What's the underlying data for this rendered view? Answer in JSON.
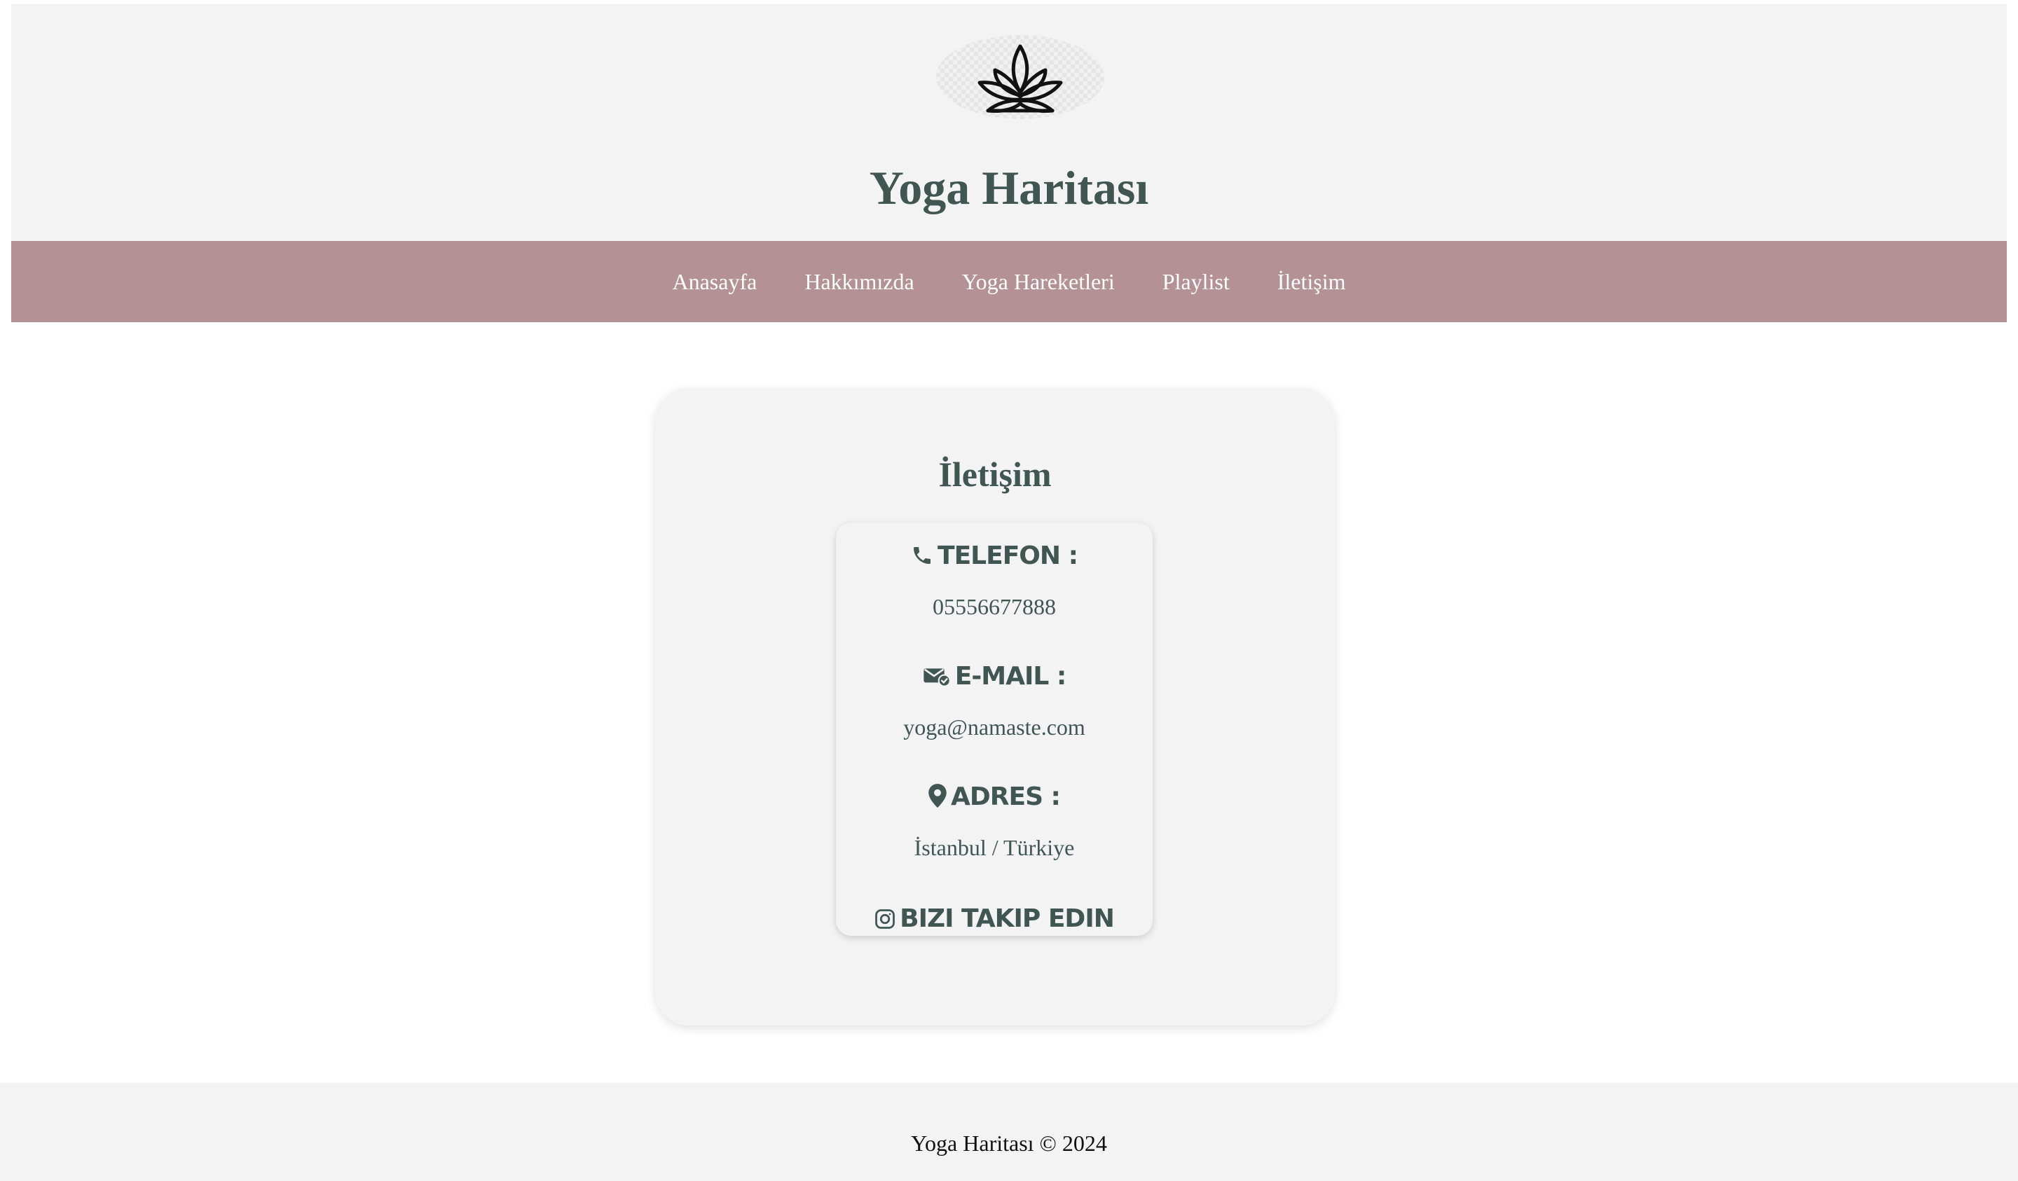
{
  "header": {
    "logo_icon": "lotus-icon",
    "site_title": "Yoga Haritası"
  },
  "nav": {
    "items": [
      {
        "label": "Anasayfa"
      },
      {
        "label": "Hakkımızda"
      },
      {
        "label": "Yoga Hareketleri"
      },
      {
        "label": "Playlist"
      },
      {
        "label": "İletişim"
      }
    ]
  },
  "contact": {
    "title": "İletişim",
    "phone": {
      "icon": "phone-icon",
      "label": "TELEFON :",
      "value": "05556677888"
    },
    "email": {
      "icon": "envelope-check-icon",
      "label": "E-MAIL :",
      "value": "yoga@namaste.com"
    },
    "address": {
      "icon": "map-pin-icon",
      "label": "ADRES :",
      "value": "İstanbul / Türkiye"
    },
    "follow": {
      "icon": "instagram-icon",
      "label": "BIZI TAKIP EDIN"
    }
  },
  "footer": {
    "text": "Yoga Haritası © 2024"
  },
  "colors": {
    "header_bg": "#f3f3f3",
    "nav_bg": "#b39194",
    "title_text": "#3f5652",
    "card_bg": "#f3f3f3"
  }
}
